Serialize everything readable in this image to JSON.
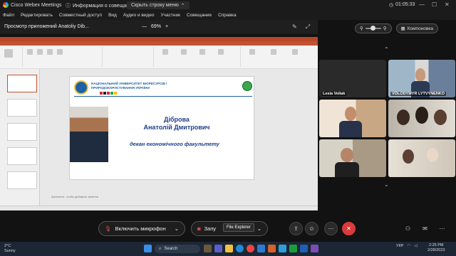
{
  "titlebar": {
    "app_name": "Cisco Webex Meetings",
    "info_label": "Информация о совещании",
    "hide_label": "Скрыть строку меню",
    "time": "01:05:33",
    "minimize": "—",
    "maximize": "☐",
    "close": "✕"
  },
  "menu": [
    "Файл",
    "Редактировать",
    "Совместный доступ",
    "Вид",
    "Аудио и видео",
    "Участник",
    "Совещание",
    "Справка"
  ],
  "share": {
    "title": "Просмотр приложений Anatoliy Dib...",
    "zoom_minus": "—",
    "zoom_value": "69%",
    "zoom_plus": "+",
    "layout_label": "Компоновка"
  },
  "slide": {
    "university": "НАЦІОНАЛЬНИЙ УНІВЕРСИТЕТ БІОРЕСУРСІВ І ПРИРОДОКОРИСТУВАННЯ УКРАЇНИ",
    "name_line1": "Діброва",
    "name_line2": "Анатолій Дмитрович",
    "role": "декан економічного факультету",
    "notes": "Щелкните, чтобы добавить заметки"
  },
  "participants": [
    {
      "name": "Lesia Voliak"
    },
    {
      "name": "VOLODYMYR LYTVYNENKO"
    },
    {
      "name": ""
    },
    {
      "name": ""
    },
    {
      "name": ""
    },
    {
      "name": ""
    }
  ],
  "controls": {
    "mic_label": "Включить микрофон",
    "video_label": "Запу",
    "tooltip": "File Explorer"
  },
  "taskbar": {
    "temp": "2°C",
    "weather": "Sunny",
    "search": "Search",
    "lang": "УКР",
    "time": "2:25 PM",
    "date": "2/28/2023"
  },
  "colors": {
    "accent_red": "#d83b3b",
    "ppt_brand": "#c4512f",
    "slide_blue": "#1f3f8a"
  }
}
